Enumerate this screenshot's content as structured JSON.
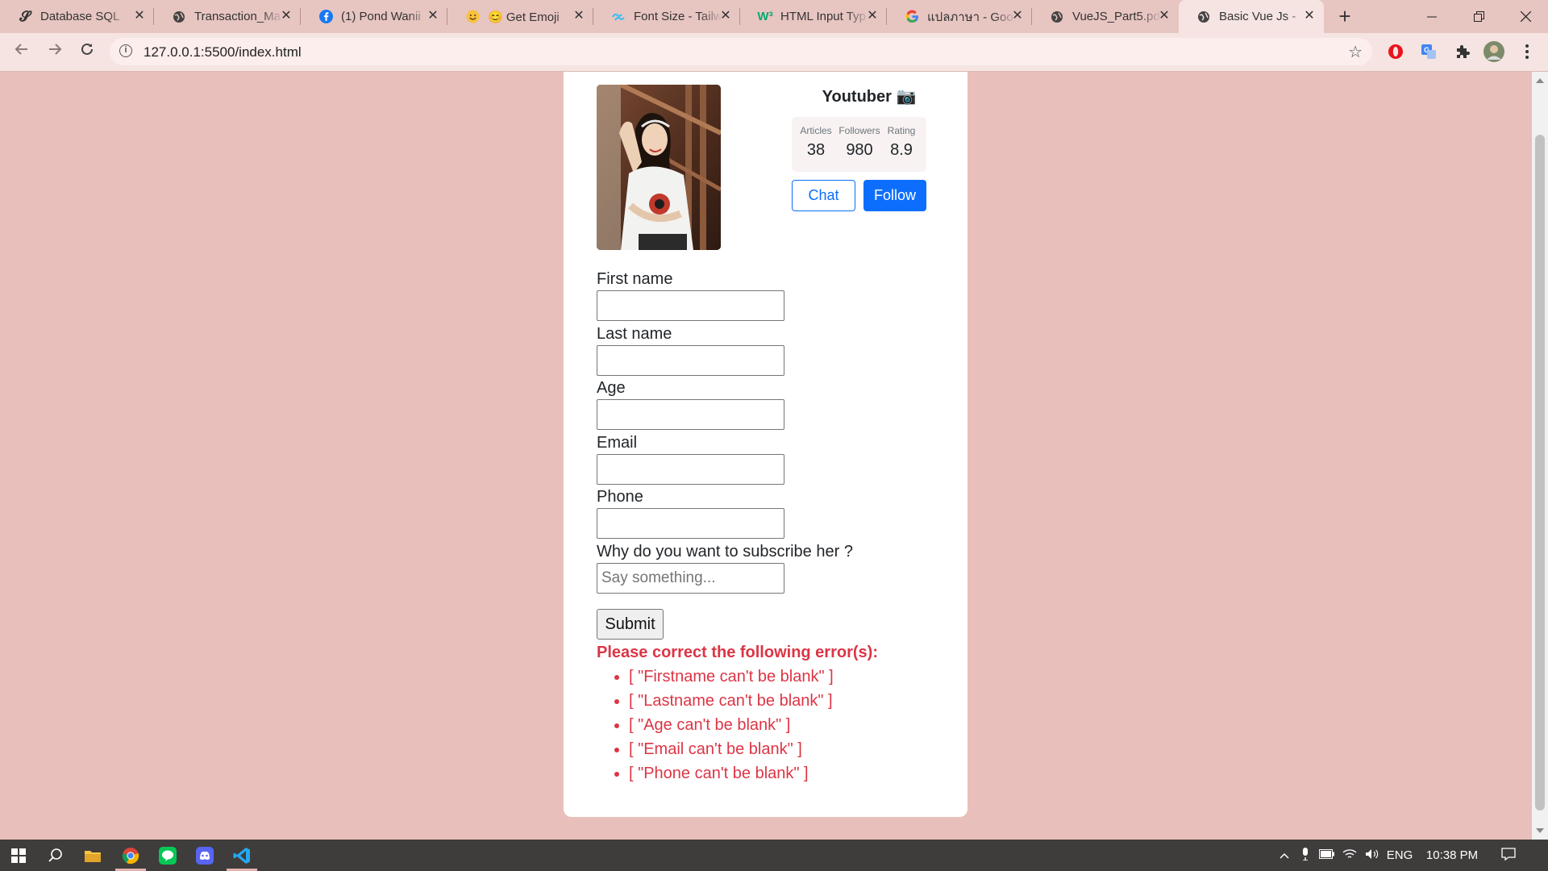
{
  "browser": {
    "tabs": [
      {
        "title": "Database SQL",
        "icon": "sketch-s-icon",
        "active": false
      },
      {
        "title": "Transaction_Ma",
        "icon": "globe-icon",
        "active": false
      },
      {
        "title": "(1) Pond Wanii",
        "icon": "facebook-icon",
        "active": false
      },
      {
        "title": "😊 Get Emoji",
        "icon": "smiley-icon",
        "active": false
      },
      {
        "title": "Font Size - Tailw",
        "icon": "tailwind-icon",
        "active": false
      },
      {
        "title": "HTML Input Typ",
        "icon": "w3schools-icon",
        "active": false
      },
      {
        "title": "แปลภาษา - Goo",
        "icon": "google-icon",
        "active": false
      },
      {
        "title": "VueJS_Part5.pd",
        "icon": "globe-icon",
        "active": false
      },
      {
        "title": "Basic Vue Js -",
        "icon": "globe-icon",
        "active": true
      }
    ],
    "url": "127.0.0.1:5500/index.html"
  },
  "profile": {
    "channel": "Youtuber 📷",
    "stats": [
      {
        "label": "Articles",
        "value": "38"
      },
      {
        "label": "Followers",
        "value": "980"
      },
      {
        "label": "Rating",
        "value": "8.9"
      }
    ],
    "chat_label": "Chat",
    "follow_label": "Follow"
  },
  "form": {
    "first_name_label": "First name",
    "last_name_label": "Last name",
    "age_label": "Age",
    "email_label": "Email",
    "phone_label": "Phone",
    "why_label": "Why do you want to subscribe her ?",
    "why_placeholder": "Say something...",
    "submit_label": "Submit"
  },
  "errors": {
    "title": "Please correct the following error(s):",
    "items": [
      "[ \"Firstname can't be blank\" ]",
      "[ \"Lastname can't be blank\" ]",
      "[ \"Age can't be blank\" ]",
      "[ \"Email can't be blank\" ]",
      "[ \"Phone can't be blank\" ]"
    ]
  },
  "taskbar": {
    "language": "ENG",
    "time": "10:38 PM"
  }
}
